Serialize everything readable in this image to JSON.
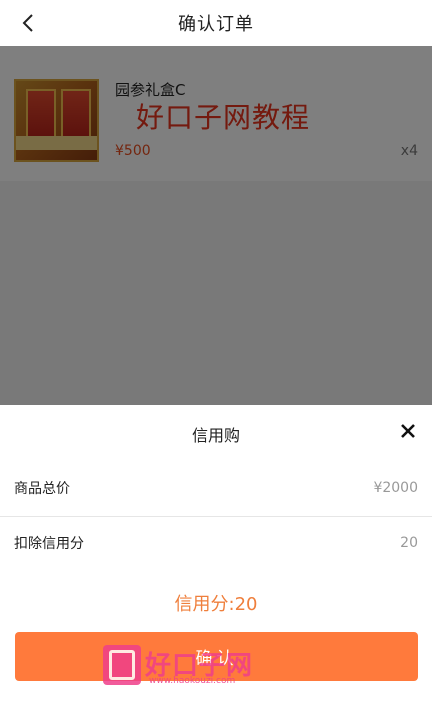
{
  "header": {
    "title": "确认订单",
    "back_icon": "chevron-left-icon"
  },
  "order": {
    "product_name": "园参礼盒C",
    "price": "¥500",
    "quantity": "x4"
  },
  "watermarks": {
    "top_text": "好口子网教程",
    "logo_text": "好口子网",
    "logo_url": "www.haokouzi.com"
  },
  "sheet": {
    "title": "信用购",
    "close_icon": "close-icon",
    "rows": [
      {
        "label": "商品总价",
        "value": "¥2000"
      },
      {
        "label": "扣除信用分",
        "value": "20"
      }
    ],
    "credit_summary": "信用分:20",
    "confirm_label": "确认"
  },
  "colors": {
    "accent": "#ff7a3c",
    "price": "#e84c1e",
    "credit_text": "#ef7f3c",
    "watermark": "#ef3f8a"
  }
}
